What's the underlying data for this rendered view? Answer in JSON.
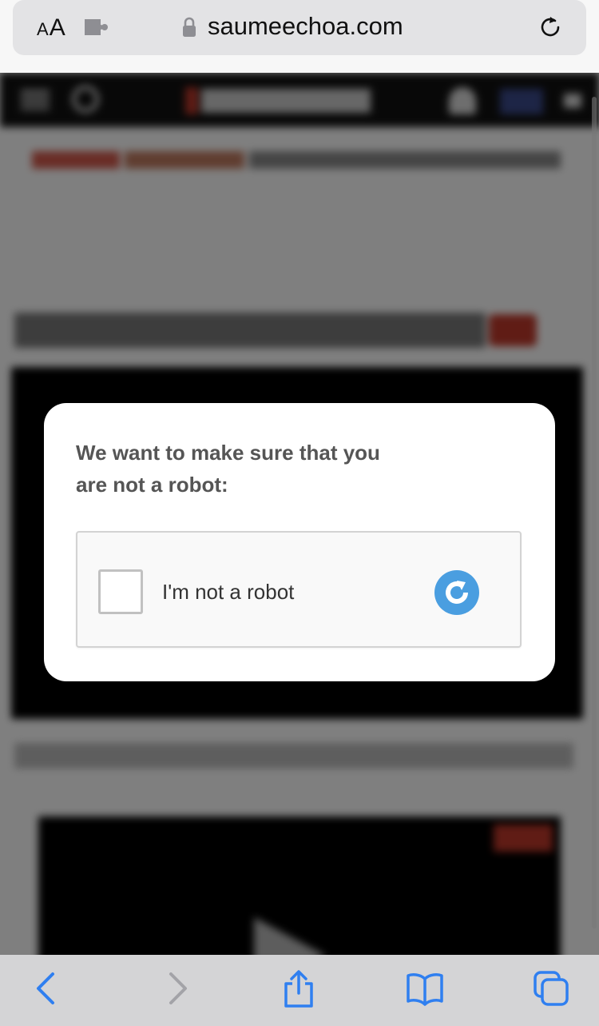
{
  "browser": {
    "text_size_label": "AA",
    "domain": "saumeechoa.com",
    "icons": {
      "text_size": "text-size-icon",
      "extension": "puzzle-extension-icon",
      "lock": "lock-icon",
      "reload": "reload-icon"
    }
  },
  "captcha": {
    "title": "We want to make sure that you are not a robot:",
    "checkbox_label": "I'm not a robot",
    "checked": false,
    "logo_icon": "captcha-refresh-icon",
    "logo_color": "#4a9ee0"
  },
  "toolbar": {
    "items": [
      {
        "name": "back",
        "icon": "chevron-left-icon",
        "enabled": true
      },
      {
        "name": "forward",
        "icon": "chevron-right-icon",
        "enabled": false
      },
      {
        "name": "share",
        "icon": "share-icon",
        "enabled": true
      },
      {
        "name": "bookmarks",
        "icon": "book-icon",
        "enabled": true
      },
      {
        "name": "tabs",
        "icon": "tabs-icon",
        "enabled": true
      }
    ],
    "accent": "#2f7ff0"
  },
  "colors": {
    "modal_background": "#ffffff",
    "overlay": "rgba(0,0,0,0.5)",
    "site_header": "#111111"
  }
}
